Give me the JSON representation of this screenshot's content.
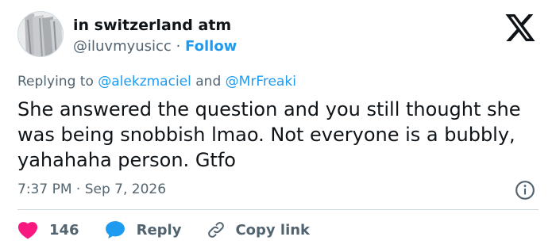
{
  "author": {
    "display_name": "in switzerland atm",
    "handle": "@iluvmyusicc",
    "separator": "·",
    "follow_label": "Follow"
  },
  "reply_context": {
    "prefix": "Replying to",
    "mention_1": "@alekzmaciel",
    "joiner": "and",
    "mention_2": "@MrFreaki"
  },
  "tweet": {
    "text": "She answered the question and you still thought she was being snobbish lmao. Not everyone is a bubbly, yahahaha person. Gtfo",
    "time": "7:37 PM",
    "separator": "·",
    "date": "Sep 7, 2026"
  },
  "actions": {
    "like_count": "146",
    "reply_label": "Reply",
    "copy_label": "Copy link"
  },
  "colors": {
    "accent": "#1d9bf0",
    "like": "#f91880",
    "muted": "#536471",
    "text": "#0f1419"
  },
  "icons": {
    "logo": "x-logo-icon",
    "info": "info-icon",
    "like": "heart-icon",
    "reply": "speech-bubble-icon",
    "copy": "link-icon"
  }
}
